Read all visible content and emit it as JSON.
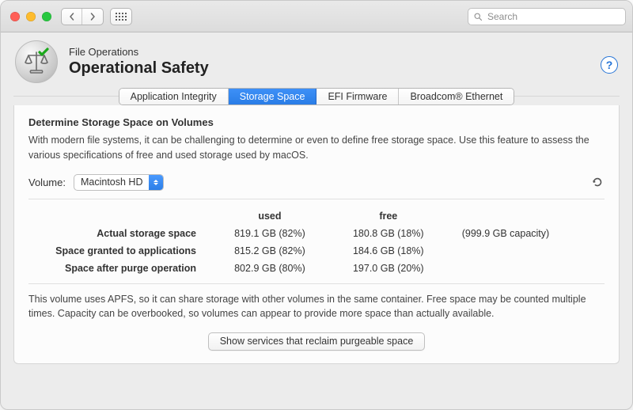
{
  "toolbar": {
    "search_placeholder": "Search"
  },
  "header": {
    "subtitle": "File Operations",
    "title": "Operational Safety",
    "help_label": "?"
  },
  "tabs": [
    {
      "label": "Application Integrity",
      "active": false
    },
    {
      "label": "Storage Space",
      "active": true
    },
    {
      "label": "EFI Firmware",
      "active": false
    },
    {
      "label": "Broadcom® Ethernet",
      "active": false
    }
  ],
  "section": {
    "title": "Determine Storage Space on Volumes",
    "description": "With modern file systems, it can be challenging to determine or even to define free storage space. Use this feature to assess the various specifications of free and used storage used by macOS."
  },
  "volume": {
    "label": "Volume:",
    "selected": "Macintosh HD"
  },
  "table": {
    "headers": {
      "used": "used",
      "free": "free"
    },
    "rows": [
      {
        "name": "Actual storage space",
        "used": "819.1 GB (82%)",
        "free": "180.8 GB (18%)",
        "capacity": "(999.9 GB capacity)"
      },
      {
        "name": "Space granted to applications",
        "used": "815.2 GB (82%)",
        "free": "184.6 GB (18%)",
        "capacity": ""
      },
      {
        "name": "Space after purge operation",
        "used": "802.9 GB (80%)",
        "free": "197.0 GB (20%)",
        "capacity": ""
      }
    ]
  },
  "note": "This volume uses APFS, so it can share storage with other volumes in the same container. Free space may be counted multiple times. Capacity can be overbooked, so volumes can appear to provide more space than actually available.",
  "footer_button": "Show services that reclaim purgeable space"
}
